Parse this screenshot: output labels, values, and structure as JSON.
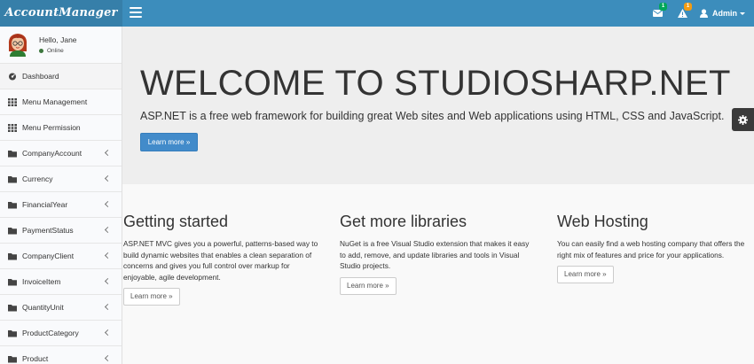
{
  "header": {
    "logo": "AccountManager",
    "messages_badge": "1",
    "alerts_badge": "1",
    "user_label": "Admin"
  },
  "sidebar": {
    "user": {
      "greeting": "Hello, Jane",
      "status": "Online"
    },
    "items": [
      {
        "label": "Dashboard",
        "icon": "dashboard-icon"
      },
      {
        "label": "Menu Management",
        "icon": "grid-icon"
      },
      {
        "label": "Menu Permission",
        "icon": "grid-icon"
      },
      {
        "label": "CompanyAccount",
        "icon": "folder-icon"
      },
      {
        "label": "Currency",
        "icon": "folder-icon"
      },
      {
        "label": "FinancialYear",
        "icon": "folder-icon"
      },
      {
        "label": "PaymentStatus",
        "icon": "folder-icon"
      },
      {
        "label": "CompanyClient",
        "icon": "folder-icon"
      },
      {
        "label": "InvoiceItem",
        "icon": "folder-icon"
      },
      {
        "label": "QuantityUnit",
        "icon": "folder-icon"
      },
      {
        "label": "ProductCategory",
        "icon": "folder-icon"
      },
      {
        "label": "Product",
        "icon": "folder-icon"
      }
    ]
  },
  "jumbotron": {
    "title": "WELCOME TO STUDIOSHARP.NET",
    "lead": "ASP.NET is a free web framework for building great Web sites and Web applications using HTML, CSS and JavaScript.",
    "button": "Learn more »"
  },
  "columns": [
    {
      "title": "Getting started",
      "text": "ASP.NET MVC gives you a powerful, patterns-based way to build dynamic websites that enables a clean separation of concerns and gives you full control over markup for enjoyable, agile development.",
      "button": "Learn more »"
    },
    {
      "title": "Get more libraries",
      "text": "NuGet is a free Visual Studio extension that makes it easy to add, remove, and update libraries and tools in Visual Studio projects.",
      "button": "Learn more »"
    },
    {
      "title": "Web Hosting",
      "text": "You can easily find a web hosting company that offers the right mix of features and price for your applications.",
      "button": "Learn more »"
    }
  ],
  "colors": {
    "header": "#3c8dbc",
    "logo_bg": "#367fa9",
    "primary_button": "#428bca",
    "jumbotron_bg": "#eeeeee"
  }
}
